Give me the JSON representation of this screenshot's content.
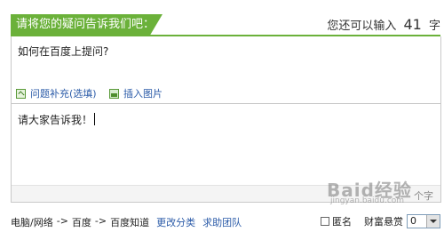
{
  "header": {
    "tab_label": "请将您的疑问告诉我们吧：",
    "counter_prefix": "您还可以输入",
    "counter_value": "41",
    "counter_suffix": "字"
  },
  "question": {
    "text": "如何在百度上提问?"
  },
  "tools": {
    "supplement_label": "问题补充",
    "supplement_optional": "(选填)",
    "insert_image_label": "插入图片"
  },
  "detail": {
    "text": "请大家告诉我！",
    "counter_text": "个字"
  },
  "watermark": {
    "text": "Baid经验",
    "sub": "jingyan.baidu.com"
  },
  "breadcrumb": {
    "items": [
      "电脑/网络",
      "百度",
      "百度知道"
    ],
    "separator": "->",
    "change_category": "更改分类",
    "help_team": "求助团队"
  },
  "options": {
    "anonymous_label": "匿名",
    "reward_label": "财富悬赏",
    "reward_value": "0"
  }
}
